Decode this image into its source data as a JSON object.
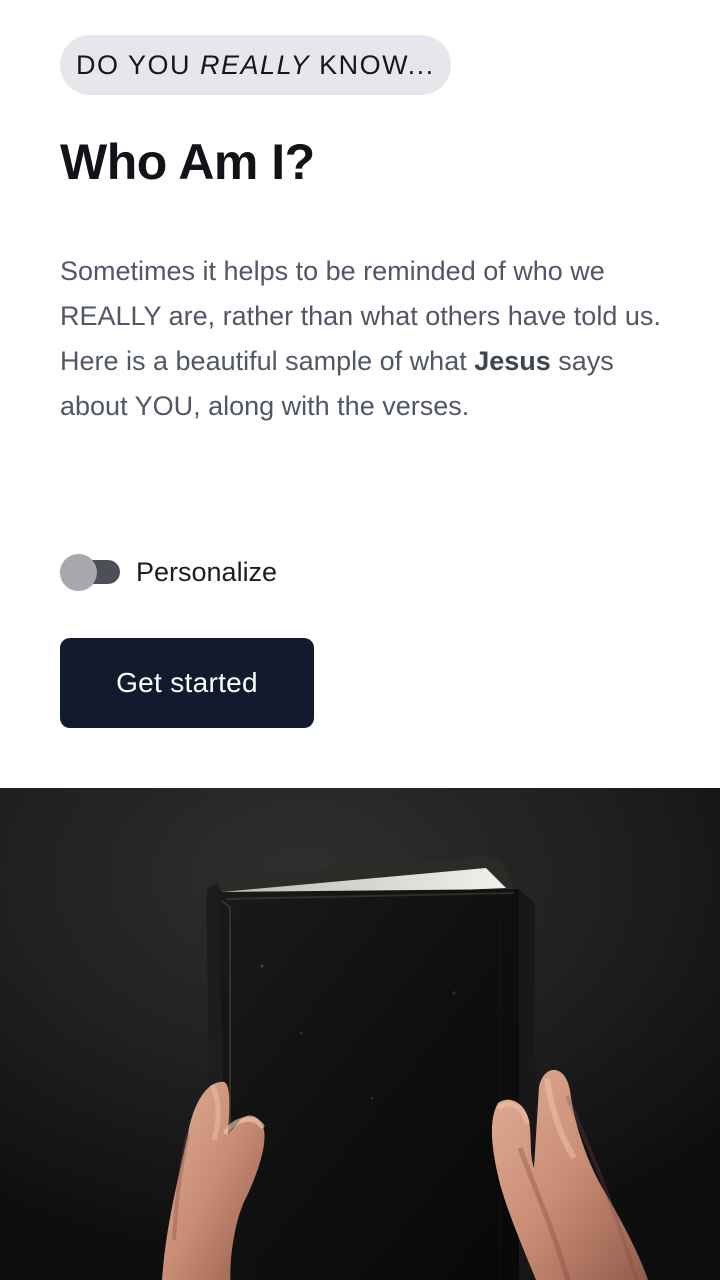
{
  "hero": {
    "eyebrow": {
      "before": "DO YOU ",
      "emphasis": "REALLY",
      "after": " KNOW..."
    },
    "title": "Who Am I?",
    "description": {
      "part1": "Sometimes it helps to be reminded of who we REALLY are, rather than what others have told us. Here is a beautiful sample of what ",
      "emphasis": "Jesus",
      "part2": " says about YOU, along with the verses."
    }
  },
  "controls": {
    "personalize": {
      "label": "Personalize",
      "checked": false
    },
    "primary_button": "Get started"
  },
  "image": {
    "subject": "hands-holding-book-photo"
  },
  "colors": {
    "pill_background": "#e6e7eb",
    "title": "#111318",
    "body_text": "#515766",
    "button_background": "#121a2d",
    "button_text": "#ffffff",
    "photo_background": "#222222"
  }
}
